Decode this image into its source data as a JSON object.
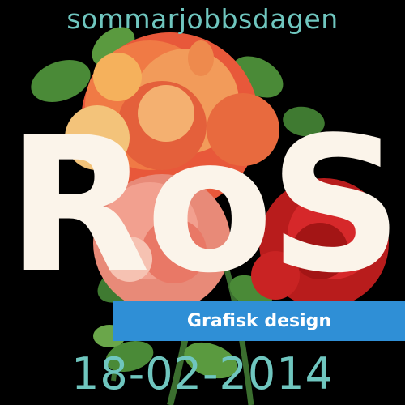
{
  "poster": {
    "event_name": "sommarjobbsdagen",
    "logo": "RoS",
    "category": "Grafisk design",
    "date": "18-02-2014"
  },
  "colors": {
    "background": "#000000",
    "accent_teal": "#6fc6bf",
    "band_blue": "#2f8fd6",
    "logo_cream": "#fbf4ea"
  },
  "illustration": {
    "image_icon": "rose-bouquet-illustration"
  }
}
